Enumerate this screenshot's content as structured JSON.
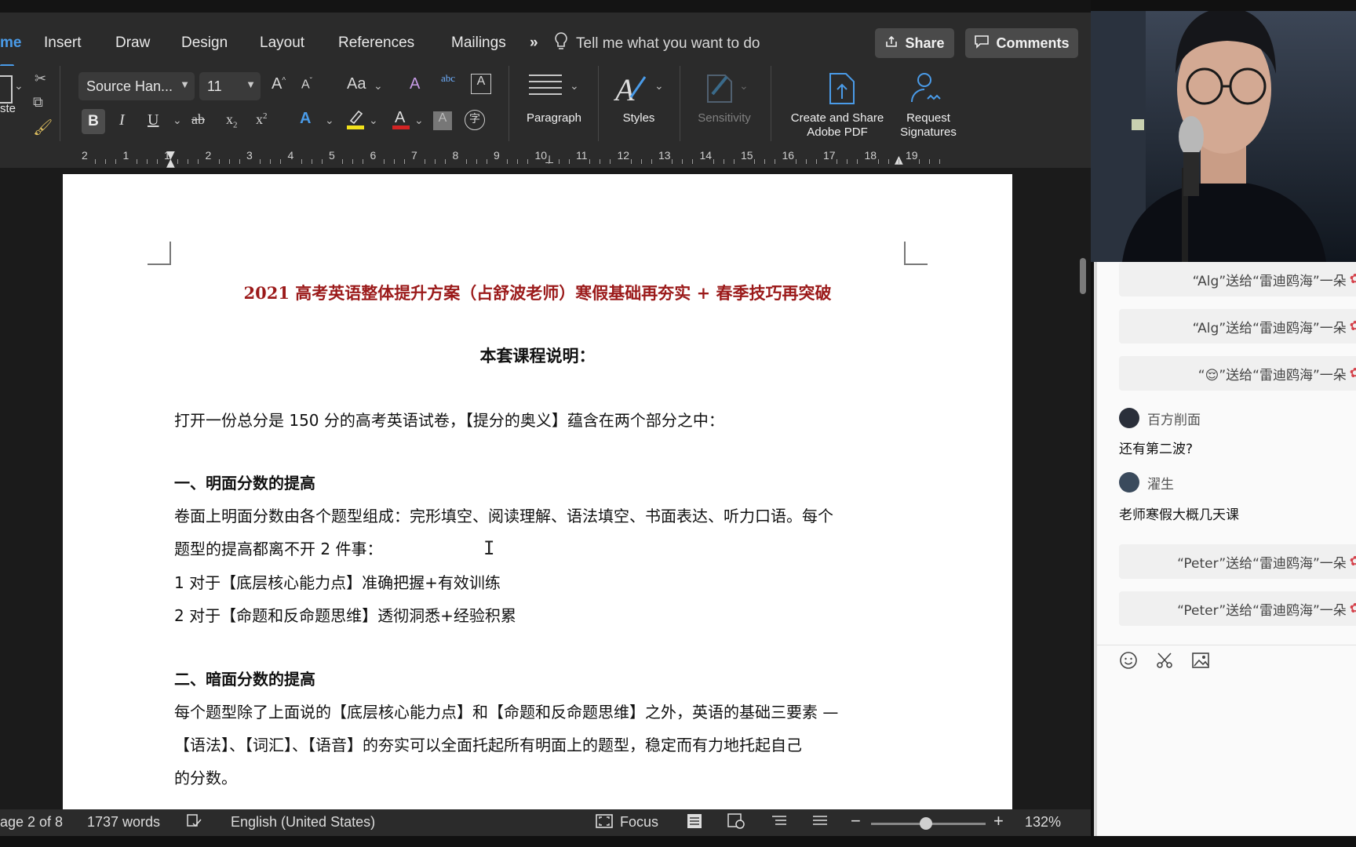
{
  "ribbon_tabs": [
    {
      "label": "me",
      "active": true
    },
    {
      "label": "Insert"
    },
    {
      "label": "Draw"
    },
    {
      "label": "Design"
    },
    {
      "label": "Layout"
    },
    {
      "label": "References"
    },
    {
      "label": "Mailings"
    }
  ],
  "overflow_label": "»",
  "tell_me": "Tell me what you want to do",
  "share_label": "Share",
  "comments_label": "Comments",
  "font": {
    "name": "Source Han...",
    "size": "11"
  },
  "ribbon_groups": {
    "paste_label": "ste",
    "paragraph_label": "Paragraph",
    "styles_label": "Styles",
    "sensitivity_label": "Sensitivity",
    "create_pdf_label_1": "Create and Share",
    "create_pdf_label_2": "Adobe PDF",
    "request_sig_label_1": "Request",
    "request_sig_label_2": "Signatures"
  },
  "ruler_numbers": [
    "2",
    "1",
    "1",
    "2",
    "3",
    "4",
    "5",
    "6",
    "7",
    "8",
    "9",
    "10",
    "11",
    "12",
    "13",
    "14",
    "15",
    "16",
    "17",
    "18",
    "19"
  ],
  "document": {
    "title": "2021 高考英语整体提升方案（占舒波老师）寒假基础再夯实 + 春季技巧再突破",
    "subtitle": "本套课程说明：",
    "intro": "打开一份总分是 150 分的高考英语试卷，【提分的奥义】蕴含在两个部分之中：",
    "section1_heading": "一、明面分数的提高",
    "section1_p1": "卷面上明面分数由各个题型组成：完形填空、阅读理解、语法填空、书面表达、听力口语。每个",
    "section1_p2": "题型的提高都离不开 2 件事：",
    "section1_item1": "1 对于【底层核心能力点】准确把握+有效训练",
    "section1_item2": "2 对于【命题和反命题思维】透彻洞悉+经验积累",
    "section2_heading": "二、暗面分数的提高",
    "section2_p1": "每个题型除了上面说的【底层核心能力点】和【命题和反命题思维】之外，英语的基础三要素 —",
    "section2_p2": "【语法】、【词汇】、【语音】的夯实可以全面托起所有明面上的题型，稳定而有力地托起自己",
    "section2_p3": "的分数。"
  },
  "status_bar": {
    "page": "age 2 of 8",
    "words": "1737 words",
    "language": "English (United States)",
    "focus": "Focus",
    "zoom": "132%",
    "zoom_level": 0.48
  },
  "chat": {
    "gifts_top": [
      "“Alg”送给“雷迪鸥海”一朵",
      "“Alg”送给“雷迪鸥海”一朵",
      "“😌”送给“雷迪鸥海”一朵"
    ],
    "messages": [
      {
        "user": "百方削面",
        "text": "还有第二波?"
      },
      {
        "user": "濯生",
        "text": "老师寒假大概几天课"
      }
    ],
    "gifts_bottom": [
      "“Peter”送给“雷迪鸥海”一朵",
      "“Peter”送给“雷迪鸥海”一朵"
    ]
  },
  "colors": {
    "accent": "#4a9be8",
    "title_red": "#9b1a1a",
    "flower": "#d5424b"
  }
}
